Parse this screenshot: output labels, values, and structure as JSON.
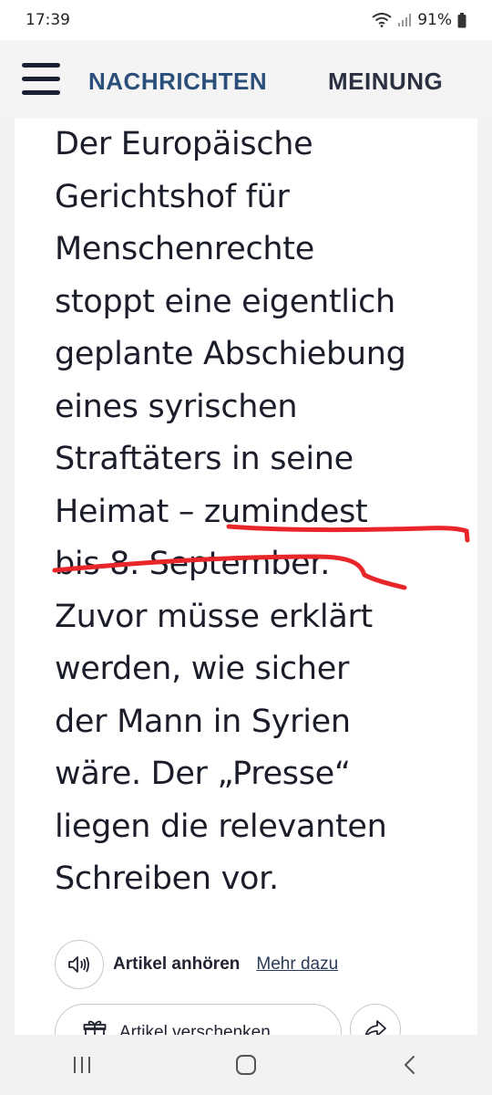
{
  "status_bar": {
    "time": "17:39",
    "battery": "91%"
  },
  "header": {
    "tabs": [
      {
        "label": "NACHRICHTEN",
        "active": true
      },
      {
        "label": "MEINUNG",
        "active": false
      }
    ]
  },
  "article": {
    "lead_lines": [
      "Der Europäische",
      "Gerichtshof für",
      "Menschenrechte",
      "stoppt eine eigentlich",
      "geplante Abschiebung",
      "eines syrischen",
      "Straftäters in seine",
      "Heimat – zumindest",
      "bis 8. September.",
      "Zuvor müsse erklärt",
      "werden, wie sicher",
      "der Mann in Syrien",
      "wäre. Der „Presse“",
      "liegen die relevanten",
      "Schreiben vor."
    ],
    "annotation_color": "#e8262a"
  },
  "actions": {
    "listen_label": "Artikel anhören",
    "more_link": "Mehr dazu",
    "gift_label": "Artikel verschenken"
  },
  "colors": {
    "accent": "#2a4f7a",
    "text": "#1b1d2a",
    "background": "#f2f2f2"
  }
}
